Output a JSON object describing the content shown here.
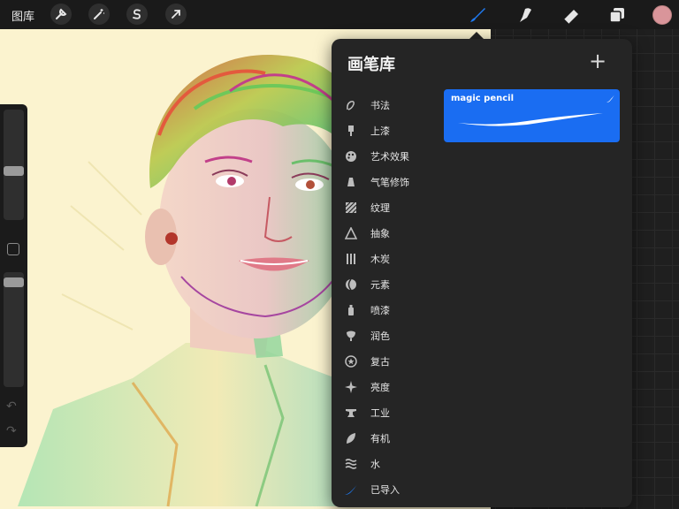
{
  "topbar": {
    "gallery_label": "图库",
    "left_tools": [
      {
        "name": "wrench-icon"
      },
      {
        "name": "magic-wand-icon"
      },
      {
        "name": "selection-s-icon"
      },
      {
        "name": "transform-arrow-icon"
      }
    ],
    "right_tools": [
      {
        "name": "brush-icon",
        "active": true
      },
      {
        "name": "smudge-icon",
        "active": false
      },
      {
        "name": "eraser-icon",
        "active": false
      },
      {
        "name": "layers-icon",
        "active": false
      }
    ],
    "current_color": "#d9959a"
  },
  "brush_library": {
    "title": "画笔库",
    "categories": [
      {
        "label": "书法",
        "icon": "calligraphy-icon"
      },
      {
        "label": "上漆",
        "icon": "paint-icon"
      },
      {
        "label": "艺术效果",
        "icon": "palette-icon"
      },
      {
        "label": "气笔修饰",
        "icon": "airbrush-icon"
      },
      {
        "label": "纹理",
        "icon": "texture-icon"
      },
      {
        "label": "抽象",
        "icon": "abstract-icon"
      },
      {
        "label": "木炭",
        "icon": "charcoal-icon"
      },
      {
        "label": "元素",
        "icon": "elements-icon"
      },
      {
        "label": "喷漆",
        "icon": "spray-paint-icon"
      },
      {
        "label": "润色",
        "icon": "touchup-icon"
      },
      {
        "label": "复古",
        "icon": "retro-icon"
      },
      {
        "label": "亮度",
        "icon": "luminance-icon"
      },
      {
        "label": "工业",
        "icon": "industrial-icon"
      },
      {
        "label": "有机",
        "icon": "organic-icon"
      },
      {
        "label": "水",
        "icon": "water-icon"
      },
      {
        "label": "已导入",
        "icon": "imported-icon"
      }
    ],
    "selected_brush": {
      "name": "magic pencil",
      "color": "#1a6df2"
    }
  }
}
